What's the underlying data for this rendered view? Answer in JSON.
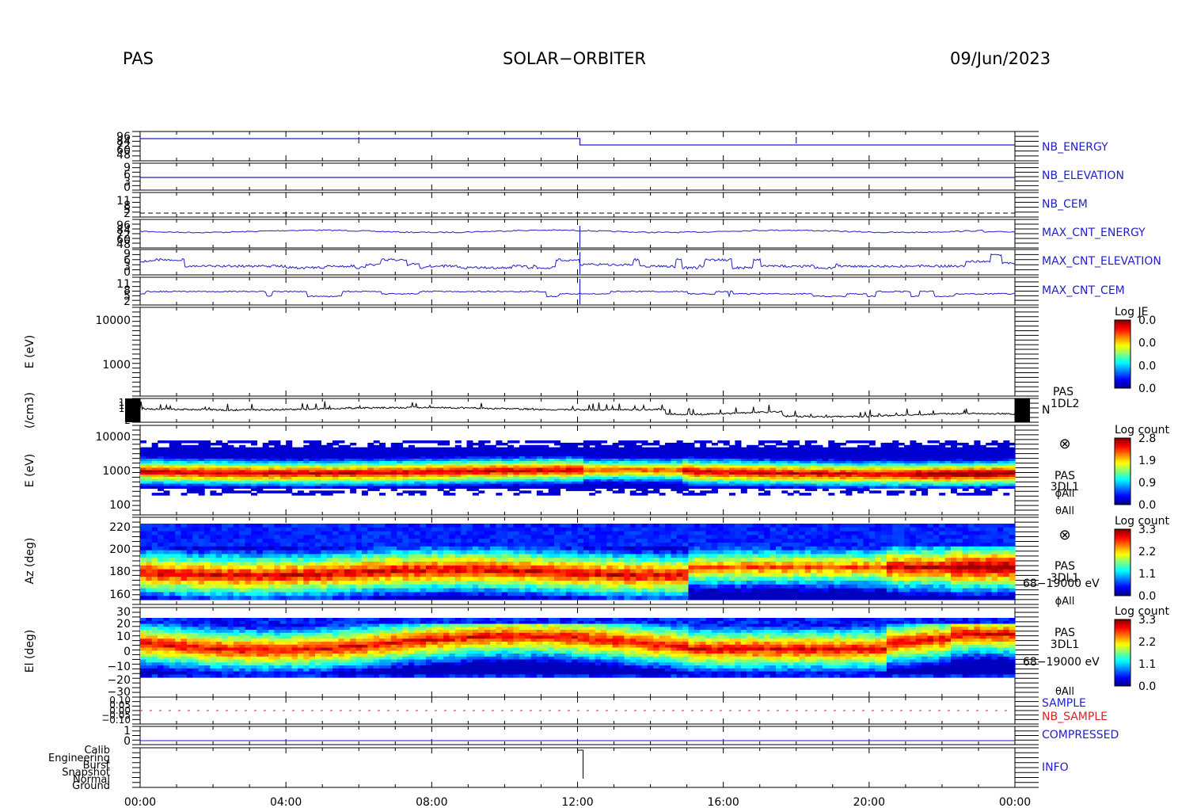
{
  "header": {
    "instrument": "PAS",
    "mission": "SOLAR−ORBITER",
    "date": "09/Jun/2023"
  },
  "colors": {
    "blue": "#1f1fc8",
    "red": "#dd2222",
    "black": "#000000"
  },
  "chart_data": {
    "type": "heatmap",
    "x_ticks": [
      "00:00",
      "04:00",
      "08:00",
      "12:00",
      "16:00",
      "20:00",
      "00:00"
    ],
    "x_range_hours": [
      0,
      24
    ],
    "panels": [
      {
        "id": "nb_energy",
        "label": "NB_ENERGY",
        "label_color": "#1f1fc8",
        "ticks": [
          "96",
          "84",
          "72",
          "60",
          "48"
        ]
      },
      {
        "id": "nb_elevation",
        "label": "NB_ELEVATION",
        "label_color": "#1f1fc8",
        "ticks": [
          "9",
          "6",
          "3",
          "0"
        ]
      },
      {
        "id": "nb_cem",
        "label": "NB_CEM",
        "label_color": "#1f1fc8",
        "ticks": [
          "11",
          "8",
          "5",
          "2"
        ]
      },
      {
        "id": "max_cnt_energy",
        "label": "MAX_CNT_ENERGY",
        "label_color": "#1f1fc8",
        "ticks": [
          "96",
          "84",
          "72",
          "60",
          "48"
        ]
      },
      {
        "id": "max_cnt_elevation",
        "label": "MAX_CNT_ELEVATION",
        "label_color": "#1f1fc8",
        "ticks": [
          "9",
          "6",
          "3",
          "0"
        ]
      },
      {
        "id": "max_cnt_cem",
        "label": "MAX_CNT_CEM",
        "label_color": "#1f1fc8",
        "ticks": [
          "11",
          "8",
          "5",
          "2"
        ]
      },
      {
        "id": "je_spectrogram",
        "ylabel": "E (eV)",
        "ticks": [
          "10000",
          "1000"
        ],
        "colorbar": {
          "title": "Log JE",
          "ticks": [
            "0.0",
            "0.0",
            "0.0",
            "0.0"
          ]
        }
      },
      {
        "id": "density",
        "ylabel": "(/cm3)",
        "ticks": [
          "14",
          "12",
          "10",
          "8",
          "6",
          "4",
          "2"
        ],
        "labels": [
          "PAS",
          "1DL2",
          "N"
        ]
      },
      {
        "id": "energy_spectrogram",
        "ylabel": "E (eV)",
        "ticks": [
          "10000",
          "1000",
          "100"
        ],
        "labels": [
          "PAS",
          "3DL1",
          "ϕAll",
          "θAll"
        ],
        "colorbar": {
          "title": "Log count",
          "ticks": [
            "2.8",
            "1.9",
            "0.9",
            "0.0"
          ]
        }
      },
      {
        "id": "azimuth_spectrogram",
        "ylabel": "Az (deg)",
        "ticks": [
          "220",
          "200",
          "180",
          "160"
        ],
        "labels": [
          "PAS",
          "3DL1",
          "68−19000 eV",
          "ϕAll"
        ],
        "colorbar": {
          "title": "Log count",
          "ticks": [
            "3.3",
            "2.2",
            "1.1",
            "0.0"
          ]
        }
      },
      {
        "id": "elevation_spectrogram",
        "ylabel": "El (deg)",
        "ticks": [
          "30",
          "20",
          "10",
          "0",
          "−10",
          "−20",
          "−30"
        ],
        "labels": [
          "PAS",
          "3DL1",
          "68−19000 eV",
          "θAll"
        ],
        "colorbar": {
          "title": "Log count",
          "ticks": [
            "3.3",
            "2.2",
            "1.1",
            "0.0"
          ]
        }
      },
      {
        "id": "sample",
        "labels": [
          "SAMPLE",
          "NB_SAMPLE"
        ],
        "ticks": [
          "0.10",
          "0.05",
          "0.00",
          "−0.05",
          "−0.10"
        ]
      },
      {
        "id": "compressed",
        "label": "COMPRESSED",
        "label_color": "#1f1fc8",
        "ticks": [
          "1",
          "0"
        ]
      },
      {
        "id": "info",
        "label": "INFO",
        "label_color": "#1f1fc8",
        "ticks": [
          "Calib",
          "Engineering",
          "Burst",
          "Snapshot",
          "Normal",
          "Ground"
        ]
      }
    ]
  }
}
